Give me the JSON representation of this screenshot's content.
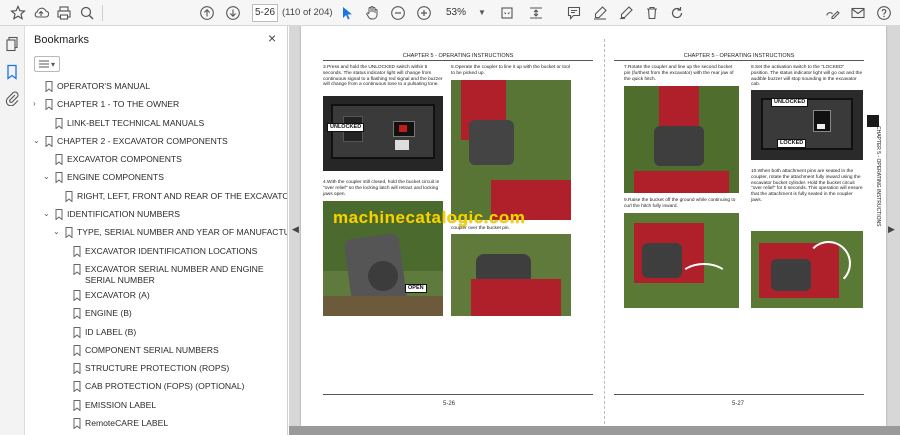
{
  "toolbar": {
    "page_value": "5-26",
    "page_count": "(110 of 204)",
    "zoom": "53%",
    "icons": [
      "bookmark-star-icon",
      "upload-cloud-icon",
      "print-icon",
      "search-zoom-icon",
      "page-up-icon",
      "page-down-icon",
      "select-arrow-icon",
      "hand-icon",
      "zoom-out-icon",
      "zoom-in-icon",
      "fit-page-icon",
      "scroll-mode-icon",
      "comment-icon",
      "highlight-icon",
      "sign-icon",
      "delete-icon",
      "rotate-icon",
      "edit-pdf-icon",
      "mail-icon",
      "help-icon"
    ]
  },
  "rail": {
    "icons": [
      "pages-icon",
      "bookmarks-icon",
      "attachments-icon"
    ]
  },
  "bookmarks": {
    "title": "Bookmarks",
    "close": "×",
    "items": [
      {
        "label": "OPERATOR'S MANUAL",
        "level": 0,
        "toggle": ""
      },
      {
        "label": "CHAPTER 1 - TO THE OWNER",
        "level": 0,
        "toggle": "›"
      },
      {
        "label": "LINK-BELT TECHNICAL MANUALS",
        "level": 1,
        "toggle": ""
      },
      {
        "label": "CHAPTER 2 - EXCAVATOR COMPONENTS",
        "level": 0,
        "toggle": "⌄"
      },
      {
        "label": "EXCAVATOR COMPONENTS",
        "level": 1,
        "toggle": ""
      },
      {
        "label": "ENGINE COMPONENTS",
        "level": 1,
        "toggle": "⌄"
      },
      {
        "label": "RIGHT, LEFT, FRONT AND REAR OF THE EXCAVATOR",
        "level": 2,
        "toggle": ""
      },
      {
        "label": "IDENTIFICATION NUMBERS",
        "level": 1,
        "toggle": "⌄"
      },
      {
        "label": "TYPE, SERIAL NUMBER AND YEAR OF MANUFACTURE",
        "level": 2,
        "toggle": "⌄"
      },
      {
        "label": "EXCAVATOR IDENTIFICATION LOCATIONS",
        "level": 3,
        "toggle": ""
      },
      {
        "label": "EXCAVATOR SERIAL NUMBER AND ENGINE SERIAL NUMBER",
        "level": 3,
        "toggle": "",
        "tall": true
      },
      {
        "label": "EXCAVATOR (A)",
        "level": 3,
        "toggle": ""
      },
      {
        "label": "ENGINE (B)",
        "level": 3,
        "toggle": ""
      },
      {
        "label": "ID LABEL (B)",
        "level": 3,
        "toggle": ""
      },
      {
        "label": "COMPONENT SERIAL NUMBERS",
        "level": 3,
        "toggle": ""
      },
      {
        "label": "STRUCTURE PROTECTION (ROPS)",
        "level": 3,
        "toggle": ""
      },
      {
        "label": "CAB PROTECTION (FOPS) (OPTIONAL)",
        "level": 3,
        "toggle": ""
      },
      {
        "label": "EMISSION LABEL",
        "level": 3,
        "toggle": ""
      },
      {
        "label": "RemoteCARE LABEL",
        "level": 3,
        "toggle": ""
      }
    ]
  },
  "document": {
    "left_page": {
      "header": "CHAPTER 5 - OPERATING INSTRUCTIONS",
      "steps": [
        "3.Press and hold the UNLOCKED switch within 5 seconds. The status indicator light will change from continuous signal to a flashing red signal and the buzzer will change from a continuous tone to a pulsating tone.",
        "4.With the coupler still closed, hold the bucket circuit in \"over relief\" so the locking latch will retract and locking jaws open.",
        "5.Operate the coupler to line it up with the bucket or tool to be picked up."
      ],
      "labels": {
        "unlocked": "UNLOCKED",
        "open": "OPEN"
      },
      "partial_text": "coupler over the bucket pin.",
      "page_number": "5-26"
    },
    "right_page": {
      "header": "CHAPTER 5 - OPERATING INSTRUCTIONS",
      "steps": [
        "7.Rotate the coupler and line up the second bucket pin (furthest from the excavator) with the rear jaw of the quick hitch.",
        "8.Set the activation switch to the \"LOCKED\" position. The status indicator light will go out and the audible buzzer will stop sounding in the excavator cab.",
        "9.Raise the bucket off the ground while continuing to curl the hitch fully inward.",
        "10.When both attachment pins are seated in the coupler, rotate the attachment fully inward using the excavator bucket cylinder. Hold the bucket circuit \"over relief\" for 5 seconds. This operation will ensure that the attachment is fully seated in the coupler jaws."
      ],
      "labels": {
        "unlocked": "UNLOCKED",
        "locked": "LOCKED"
      },
      "page_number": "5-27",
      "tab_label": "CHAPTER 5 - OPERATING INSTRUCTIONS"
    },
    "watermark": "machinecatalogic.com"
  },
  "colors": {
    "accent": "#1a73e8",
    "machine_red": "#b0202a",
    "grass": "#5e7a3d"
  }
}
